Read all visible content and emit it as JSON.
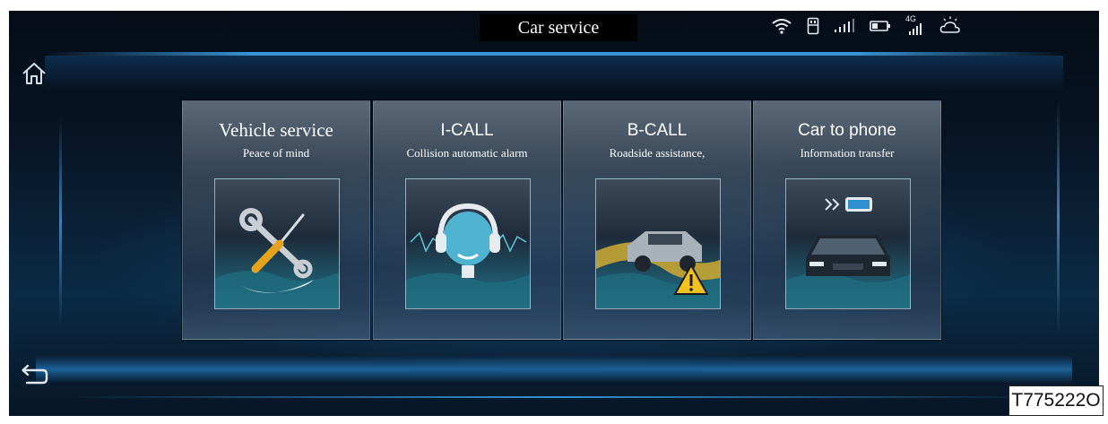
{
  "header": {
    "title": "Car service"
  },
  "status_bar": {
    "icons": [
      "wifi-icon",
      "usb-icon",
      "signal-icon",
      "battery-icon",
      "4g-signal-icon",
      "weather-icon"
    ],
    "network_label": "4G"
  },
  "navigation": {
    "home_icon": "home-icon",
    "back_icon": "back-arrow-icon"
  },
  "cards": [
    {
      "title": "Vehicle service",
      "subtitle": "Peace of mind",
      "icon": "wrench-screwdriver-icon"
    },
    {
      "title": "I-CALL",
      "subtitle": "Collision automatic alarm",
      "icon": "headset-agent-icon"
    },
    {
      "title": "B-CALL",
      "subtitle": "Roadside assistance,",
      "icon": "roadside-car-warning-icon"
    },
    {
      "title": "Car to phone",
      "subtitle": "Information transfer",
      "icon": "car-phone-transfer-icon"
    }
  ],
  "figure_code": "T775222O",
  "colors": {
    "accent": "#3ca0e6",
    "background": "#06101c",
    "text": "#ffffff"
  }
}
